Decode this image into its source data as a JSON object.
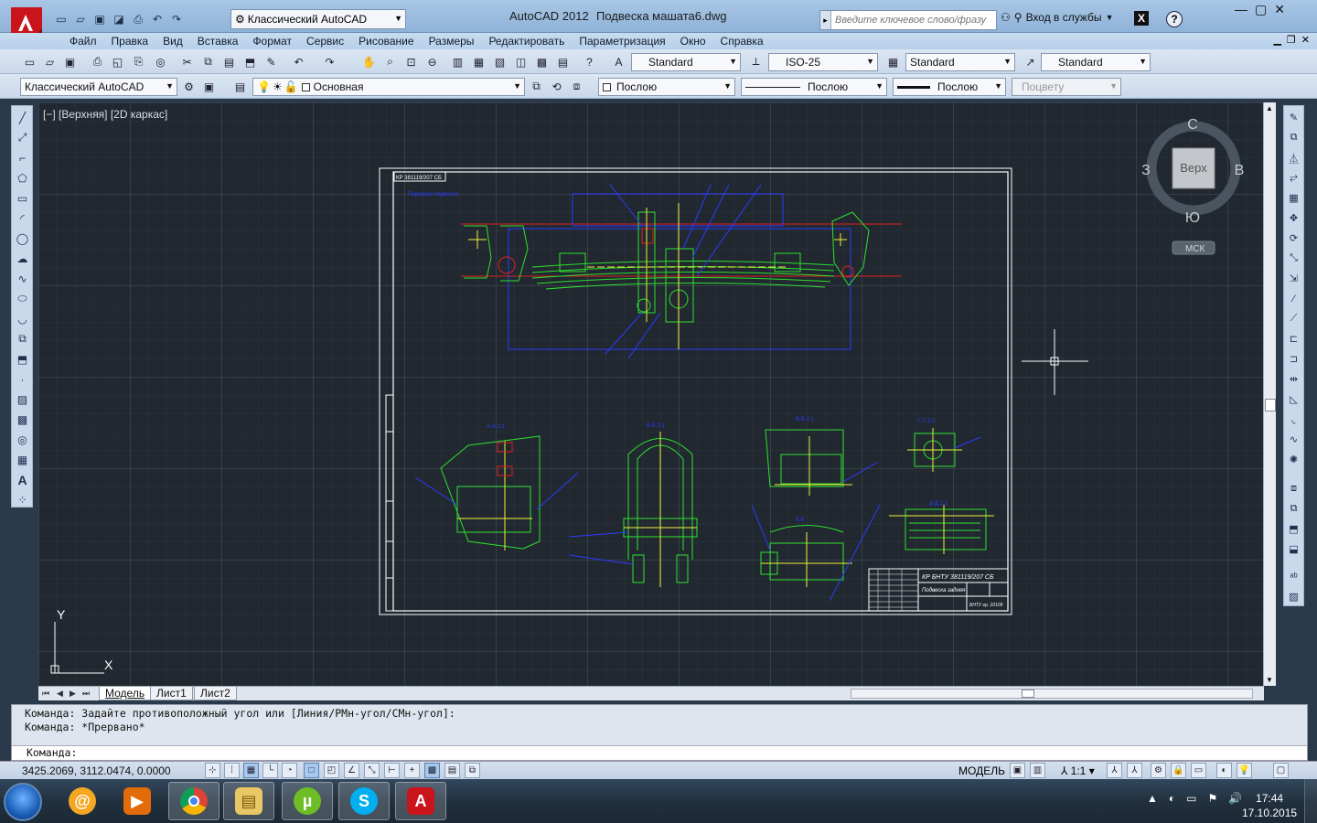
{
  "titlebar": {
    "workspace": "Классический AutoCAD",
    "app_title": "AutoCAD 2012",
    "doc_title": "Подвеска машата6.dwg",
    "search_placeholder": "Введите ключевое слово/фразу",
    "login": "Вход в службы",
    "help": "?",
    "x_label": "X"
  },
  "menu": [
    "Файл",
    "Правка",
    "Вид",
    "Вставка",
    "Формат",
    "Сервис",
    "Рисование",
    "Размеры",
    "Редактировать",
    "Параметризация",
    "Окно",
    "Справка"
  ],
  "toolbar1": {
    "text_style": "Standard",
    "dim_style": "ISO-25",
    "table_style": "Standard",
    "mleader_style": "Standard"
  },
  "toolbar2": {
    "workspace": "Классический AutoCAD",
    "layer": "Основная",
    "color": "Послою",
    "linetype": "Послою",
    "lineweight": "Послою",
    "plotstyle": "Поцвету"
  },
  "viewport": {
    "label": "[−] [Верхняя] [2D каркас]",
    "viewcube": {
      "north": "С",
      "south": "Ю",
      "west": "З",
      "east": "В",
      "face": "Верх",
      "ucs": "МСК"
    },
    "ucs_x": "X",
    "ucs_y": "Y"
  },
  "layout_tabs": [
    "Модель",
    "Лист1",
    "Лист2"
  ],
  "active_tab": "Модель",
  "command": {
    "history": [
      "Команда: Задайте противоположный угол или [Линия/РМн-угол/СМн-угол]:",
      "Команда: *Прервано*"
    ],
    "prompt": "Команда:"
  },
  "status": {
    "coords": "3425.2069, 3112.0474, 0.0000",
    "model": "МОДЕЛЬ",
    "scale": "1:1"
  },
  "drawing_text": {
    "stamp_title": "КР БНТУ 381119/207 СБ",
    "stamp_name": "Подвеска задняя",
    "stamp_org": "БНТУ гр. 10109",
    "corner_stamp": "КР 381119/207 СБ",
    "note": "Передняя подвеска",
    "sec_aa": "А-А 2:1",
    "sec_bb": "Б-Б 2:1",
    "sec_vv": "В-В 2:1",
    "sec_gg": "Г-Г 2:1",
    "sec_dd": "Д-Д 2:1",
    "sec_ee": "Е-Е"
  },
  "taskbar": {
    "time": "17:44",
    "date": "17.10.2015",
    "apps": [
      "mail-agent",
      "chrome",
      "explorer",
      "utorrent",
      "skype",
      "autocad"
    ]
  },
  "colors": {
    "drawing_bg": "#212830",
    "green": "#2ee02e",
    "blue": "#2b3cff",
    "red": "#e02020",
    "yellow": "#f2f23a"
  }
}
